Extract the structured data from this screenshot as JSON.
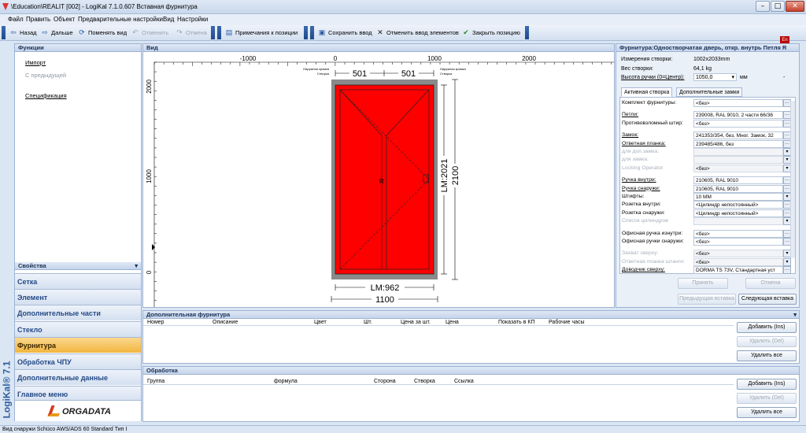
{
  "window": {
    "title": "\\Education\\REALIT [002] - LogiKal 7.1.0.607 Вставная фурнитура",
    "buttons": {
      "minimize": "–",
      "maximize": "□",
      "close": "✕"
    }
  },
  "menu": [
    "Файл",
    "Править",
    "Объект",
    "Предварительные настройки",
    "Вид",
    "Настройки"
  ],
  "toolbar": {
    "back": "Назад",
    "forward": "Дальше",
    "change_view": "Поменять вид",
    "undo": "Отменить",
    "redo": "Отмена",
    "position_notes": "Примечания к позиции",
    "save_input": "Сохранить ввод",
    "cancel_input": "Отменить ввод элементов",
    "close_position": "Закрыть позицию"
  },
  "lang_badge": "En",
  "functions": {
    "header": "Функции",
    "items": [
      {
        "label": "Импорт",
        "enabled": true
      },
      {
        "label": "С предыдущей",
        "enabled": false
      },
      {
        "label": "Спецификация",
        "enabled": true
      }
    ]
  },
  "properties_header": "Свойства",
  "left_nav": [
    {
      "label": "Сетка",
      "active": false
    },
    {
      "label": "Элемент",
      "active": false
    },
    {
      "label": "Дополнительные части",
      "active": false
    },
    {
      "label": "Стекло",
      "active": false
    },
    {
      "label": "Фурнитура",
      "active": true
    },
    {
      "label": "Обработка ЧПУ",
      "active": false
    },
    {
      "label": "Дополнительные данные",
      "active": false
    },
    {
      "label": "Главное меню",
      "active": false
    }
  ],
  "brand": {
    "vertical": "LogiKal® 7.1",
    "logo": "ORGADATA"
  },
  "view": {
    "header": "Вид",
    "ruler_x": [
      "-1000",
      "0",
      "1000",
      "2000"
    ],
    "ruler_y": [
      "2000",
      "1000",
      "0"
    ],
    "dims": {
      "top_left": "501",
      "top_right": "501",
      "right_inner": "LM:2021",
      "right_outer": "2100",
      "bottom_inner": "LM:962",
      "bottom_outer": "1100"
    },
    "small_labels": {
      "left_top": "Наружная кромка",
      "left_bottom": "Створка",
      "right_top": "Наружная кромка",
      "right_bottom": "Створка"
    },
    "handle_mark": "R",
    "door_color": "#ff0000",
    "frame_color": "#8a8a8a"
  },
  "hardware": {
    "header": "Фурнитура:Одностворчатая дверь, откр. внутрь Петля R",
    "summary": [
      {
        "label": "Измерения створки:",
        "value": "1002x2033mm"
      },
      {
        "label": "Вес створки:",
        "value": "64,1 kg"
      },
      {
        "label": "Высота ручки (0=Центр):",
        "value": "1050,0",
        "unit": "мм"
      }
    ],
    "tabs": [
      "Активная створка",
      "Дополнительные замки"
    ],
    "rows": [
      {
        "label": "Комплект фурнитуры:",
        "value": "<без>",
        "enabled": true,
        "ul": false
      },
      {
        "label": "",
        "value": "",
        "enabled": true,
        "ul": false,
        "spacer": true
      },
      {
        "label": "Петли:",
        "value": "239008, RAL 9010, 2 части 66/36",
        "enabled": true,
        "ul": true
      },
      {
        "label": "Противовзломный штир:",
        "value": "<без>",
        "enabled": true,
        "ul": false
      },
      {
        "label": "",
        "value": "",
        "enabled": true,
        "ul": false,
        "spacer": true
      },
      {
        "label": "Замок:",
        "value": "241353/354, без, Мног. Замок, 32",
        "enabled": true,
        "ul": true
      },
      {
        "label": "Ответная планка:",
        "value": "239485/486, без",
        "enabled": true,
        "ul": true
      },
      {
        "label": "для доп.замка:",
        "value": "",
        "enabled": false,
        "ul": false
      },
      {
        "label": "для замка:",
        "value": "",
        "enabled": false,
        "ul": false
      },
      {
        "label": "Locking Operator:",
        "value": "<без>",
        "enabled": false,
        "ul": false
      },
      {
        "label": "",
        "value": "",
        "enabled": true,
        "ul": false,
        "spacer": true
      },
      {
        "label": "Ручка внутри:",
        "value": "210605, RAL 9010",
        "enabled": true,
        "ul": true
      },
      {
        "label": "Ручка снаружи:",
        "value": "210605, RAL 9010",
        "enabled": true,
        "ul": true
      },
      {
        "label": "Штифты:",
        "value": "10 MM",
        "enabled": true,
        "ul": false
      },
      {
        "label": "Розетка внутри:",
        "value": "<Цилиндр непостоянный>",
        "enabled": true,
        "ul": false
      },
      {
        "label": "Розетка снаружи:",
        "value": "<Цилиндр непостоянный>",
        "enabled": true,
        "ul": false
      },
      {
        "label": "Список цилиндров",
        "value": "",
        "enabled": false,
        "ul": false
      },
      {
        "label": "",
        "value": "",
        "enabled": true,
        "ul": false,
        "spacer": true
      },
      {
        "label": "Офисная ручка изнутри:",
        "value": "<без>",
        "enabled": true,
        "ul": false
      },
      {
        "label": "Офисная ручки снаружи:",
        "value": "<без>",
        "enabled": true,
        "ul": false
      },
      {
        "label": "",
        "value": "",
        "enabled": true,
        "ul": false,
        "spacer": true
      },
      {
        "label": "Захват сверху:",
        "value": "<без>",
        "enabled": false,
        "ul": false
      },
      {
        "label": "Ответная планка штанги:",
        "value": "<без>",
        "enabled": false,
        "ul": false
      },
      {
        "label": "Доводчик сверху:",
        "value": "DORMA TS 73V, Стандартная уст",
        "enabled": true,
        "ul": true
      }
    ],
    "buttons": {
      "apply": "Принять",
      "cancel": "Отмена",
      "prev": "Предыдущая вставка",
      "next": "Следующая вставка"
    }
  },
  "additional_hardware": {
    "header": "Дополнительная фурнитура",
    "columns": [
      "Номер",
      "Описание",
      "Цвет",
      "Шт.",
      "Цена за шт.",
      "Цена",
      "Показать в КП",
      "Рабочие часы"
    ],
    "buttons": {
      "add": "Добавить (Ins)",
      "delete": "Удалить (Del)",
      "delete_all": "Удалить все"
    }
  },
  "processing": {
    "header": "Обработка",
    "columns": [
      "Группа",
      "формула",
      "Сторона",
      "Створка",
      "Ссылка"
    ],
    "buttons": {
      "add": "Добавить (Ins)",
      "delete": "Удалить (Del)",
      "delete_all": "Удалить все"
    }
  },
  "status": "Вид снаружи   Schüco AWS/ADS 60 Standard Тип I"
}
